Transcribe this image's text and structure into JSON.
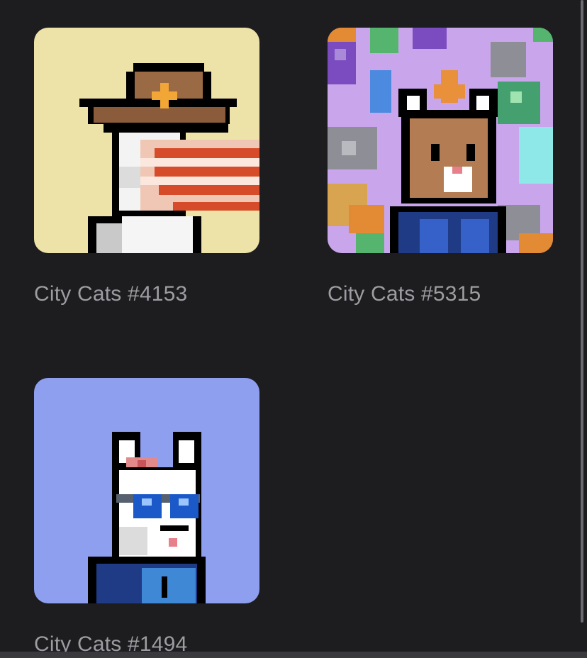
{
  "collection": {
    "items": [
      {
        "name": "City Cats #4153",
        "background": "#ede3a8"
      },
      {
        "name": "City Cats #5315",
        "background": "#c9a6ec"
      },
      {
        "name": "City Cats #1494",
        "background": "#8e9ff0"
      }
    ]
  },
  "colors": {
    "page_background": "#1d1c1f",
    "caption_text": "#9d9ca1"
  }
}
